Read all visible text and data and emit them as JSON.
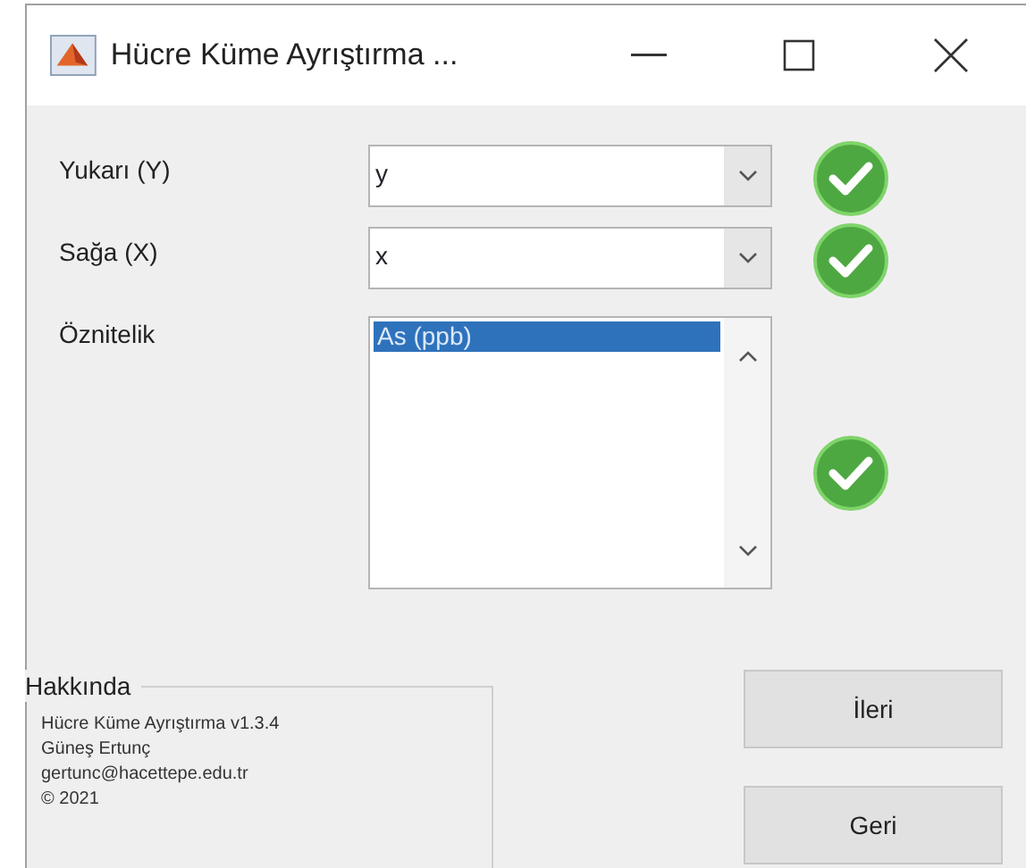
{
  "window": {
    "title": "Hücre Küme Ayrıştırma ..."
  },
  "fields": [
    {
      "label": "Yukarı (Y)",
      "kind": "dropdown",
      "value": "y",
      "valid": true
    },
    {
      "label": "Sağa (X)",
      "kind": "dropdown",
      "value": "x",
      "valid": true
    },
    {
      "label": "Öznitelik",
      "kind": "listbox",
      "items": [
        {
          "text": "As (ppb)",
          "selected": true
        }
      ],
      "valid": true
    }
  ],
  "about": {
    "title": "Hakkında",
    "lines": [
      "Hücre Küme Ayrıştırma v1.3.4",
      "Güneş Ertunç",
      "gertunc@hacettepe.edu.tr",
      "© 2021"
    ]
  },
  "buttons": [
    "İleri",
    "Geri"
  ]
}
